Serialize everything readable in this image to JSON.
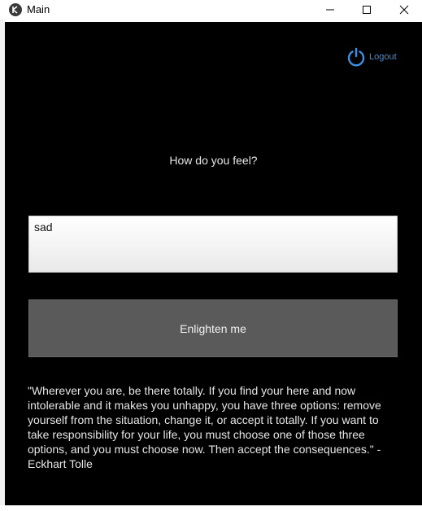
{
  "window": {
    "title": "Main"
  },
  "header": {
    "logout_label": "Logout"
  },
  "main": {
    "prompt": "How do you feel?",
    "feeling_value": "sad",
    "submit_label": "Enlighten me",
    "quote": "\"Wherever you are, be there totally. If you find your here and now intolerable and it makes you unhappy, you have three options: remove yourself from the situation, change it, or accept it totally. If you want to take responsibility for your life, you must choose one of those three options, and you must choose now. Then accept the consequences.\" - Eckhart Tolle"
  },
  "colors": {
    "background": "#000000",
    "button": "#5a5a5a",
    "accent": "#3d8fe0"
  },
  "icons": {
    "app": "kivy-app-icon",
    "logout": "power-icon",
    "minimize": "minimize-icon",
    "maximize": "maximize-icon",
    "close": "close-icon"
  }
}
